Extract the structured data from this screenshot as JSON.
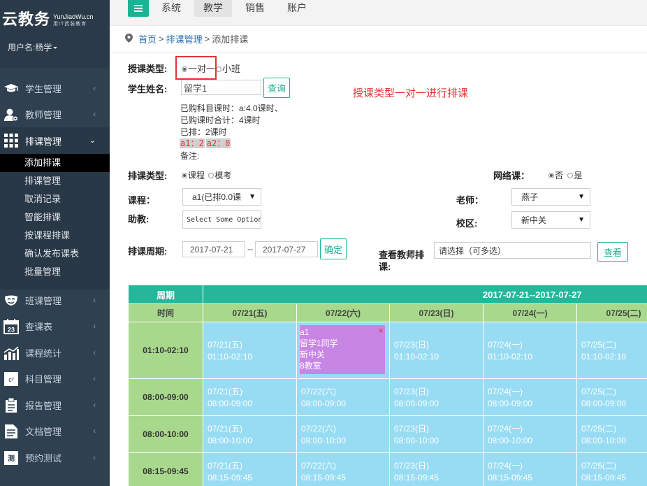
{
  "brand": {
    "name": "云教务",
    "en": "YunJiaoWu.cn",
    "cn": "用IT武装教育",
    "user": "用户名:杨学"
  },
  "sidebar": {
    "items": [
      {
        "label": "学生管理",
        "icon": "graduation-cap-icon"
      },
      {
        "label": "教师管理",
        "icon": "teacher-icon"
      },
      {
        "label": "排课管理",
        "icon": "grid-icon"
      },
      {
        "label": "班课管理",
        "icon": "mask-icon"
      },
      {
        "label": "查课表",
        "icon": "calendar-icon"
      },
      {
        "label": "课程统计",
        "icon": "bar-chart-icon"
      },
      {
        "label": "科目管理",
        "icon": "formula-icon"
      },
      {
        "label": "报告管理",
        "icon": "report-icon"
      },
      {
        "label": "文档管理",
        "icon": "document-icon"
      },
      {
        "label": "预约测试",
        "icon": "test-icon"
      }
    ],
    "subitems": [
      "添加排课",
      "排课管理",
      "取消记录",
      "智能排课",
      "按课程排课",
      "确认发布课表",
      "批量管理"
    ]
  },
  "topnav": {
    "tabs": [
      "系统",
      "教学",
      "销售",
      "账户"
    ]
  },
  "breadcrumb": {
    "home": "首页",
    "section": "排课管理",
    "current": "添加排课",
    "sep": ">"
  },
  "form": {
    "teach_type_label": "授课类型:",
    "teach_type_opt1": "一对一",
    "teach_type_opt2": "小班",
    "student_label": "学生姓名:",
    "student_value": "留学1",
    "query_btn": "查询",
    "info_purchased": "已购科目课时：a:4.0课时、",
    "info_total": "已购课时合计：4课时",
    "info_scheduled": "已排：2课时",
    "info_a1": "a1：2",
    "info_a2": "a2：0",
    "info_note": "备注:",
    "annotation": "授课类型一对一进行排课",
    "sched_type_label": "排课类型:",
    "sched_type_opt1": "课程",
    "sched_type_opt2": "模考",
    "online_label": "网络课：",
    "online_opt1": "否",
    "online_opt2": "是",
    "course_label": "课程：",
    "course_value": "a1(已排0.0课",
    "teacher_label": "老师：",
    "teacher_value": "燕子",
    "assistant_label": "助教:",
    "assistant_placeholder": "Select Some Options",
    "campus_label": "校区:",
    "campus_value": "新中关",
    "period_label": "排课周期:",
    "start_date": "2017-07-21",
    "period_sep": "--",
    "end_date": "2017-07-27",
    "confirm_btn": "确定",
    "view_teacher_label_1": "查看教师排",
    "view_teacher_label_2": "课:",
    "view_teacher_placeholder": "请选择（可多选）",
    "view_btn": "查看"
  },
  "schedule": {
    "period_header": "周期",
    "time_header": "时间",
    "range": "2017-07-21--2017-07-27",
    "days": [
      "07/21(五)",
      "07/22(六)",
      "07/23(日)",
      "07/24(一)",
      "07/25(二)"
    ],
    "slots": [
      "01:10-02:10",
      "08:00-09:00",
      "08:00-10:00",
      "08:15-09:45"
    ],
    "booking": {
      "course": "a1",
      "student": "留学1同学",
      "campus": "新中关",
      "room": "8教室",
      "close": "×"
    }
  },
  "colors": {
    "accent": "#1ab394",
    "sidebar": "#2f4050",
    "slot": "#98dcf4",
    "booking": "#c886e4",
    "header": "#25b79a",
    "time": "#a8d88c"
  }
}
